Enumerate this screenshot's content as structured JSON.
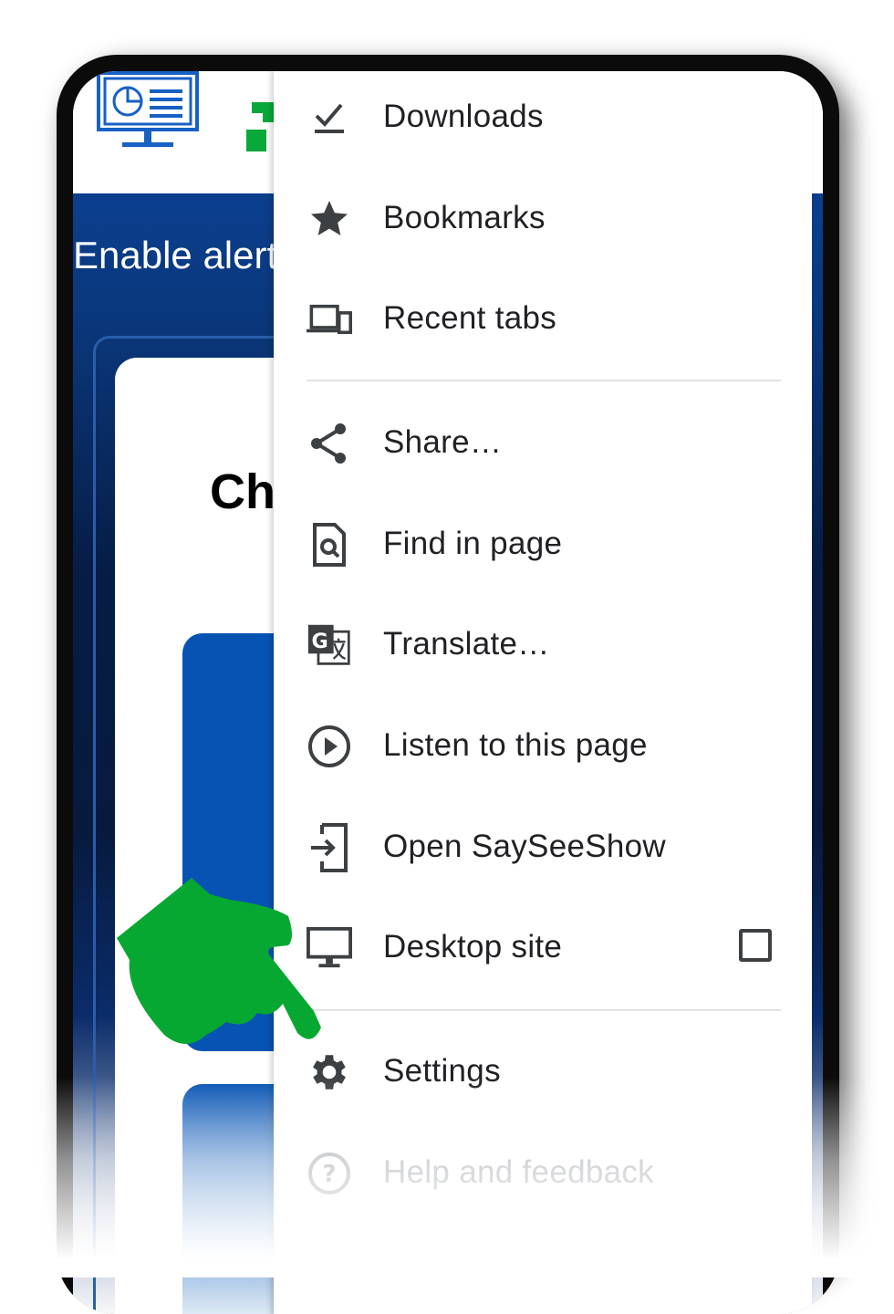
{
  "page": {
    "banner_title": "Enable alert",
    "card_heading": "Ch"
  },
  "menu": {
    "items": [
      {
        "id": "downloads",
        "label": "Downloads",
        "icon": "download-done-icon"
      },
      {
        "id": "bookmarks",
        "label": "Bookmarks",
        "icon": "star-icon"
      },
      {
        "id": "recent-tabs",
        "label": "Recent tabs",
        "icon": "devices-icon"
      },
      {
        "id": "share",
        "label": "Share…",
        "icon": "share-icon"
      },
      {
        "id": "find-in-page",
        "label": "Find in page",
        "icon": "find-in-page-icon"
      },
      {
        "id": "translate",
        "label": "Translate…",
        "icon": "translate-icon"
      },
      {
        "id": "listen",
        "label": "Listen to this page",
        "icon": "play-circle-icon"
      },
      {
        "id": "open-app",
        "label": "Open SaySeeShow",
        "icon": "open-in-app-icon"
      },
      {
        "id": "desktop-site",
        "label": "Desktop site",
        "icon": "desktop-icon",
        "checked": false
      },
      {
        "id": "settings",
        "label": "Settings",
        "icon": "gear-icon"
      },
      {
        "id": "help",
        "label": "Help and feedback",
        "icon": "help-icon"
      }
    ]
  },
  "colors": {
    "banner": "#0b3f8f",
    "accent_blue": "#0753b3",
    "pointer_green": "#07a832",
    "menu_text": "#202124",
    "icon": "#3c4043"
  },
  "pointer": {
    "icon": "pointing-hand-icon"
  }
}
